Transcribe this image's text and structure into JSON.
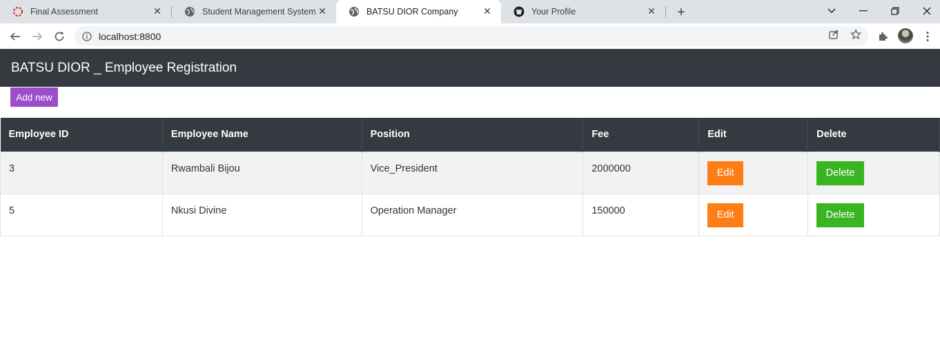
{
  "browser": {
    "tabs": [
      {
        "title": "Final Assessment",
        "icon": "loading-ring-icon",
        "active": false
      },
      {
        "title": "Student Management System",
        "icon": "globe-icon",
        "active": false
      },
      {
        "title": "BATSU DIOR Company",
        "icon": "globe-icon",
        "active": true
      },
      {
        "title": "Your Profile",
        "icon": "github-icon",
        "active": false
      }
    ],
    "url": "localhost:8800"
  },
  "header": {
    "title": "BATSU DIOR _ Employee Registration"
  },
  "actions": {
    "add_new_label": "Add new"
  },
  "table": {
    "columns": [
      "Employee ID",
      "Employee Name",
      "Position",
      "Fee",
      "Edit",
      "Delete"
    ],
    "rows": [
      {
        "id": "3",
        "name": "Rwambali Bijou",
        "position": "Vice_President",
        "fee": "2000000",
        "edit_label": "Edit",
        "delete_label": "Delete"
      },
      {
        "id": "5",
        "name": "Nkusi Divine",
        "position": "Operation Manager",
        "fee": "150000",
        "edit_label": "Edit",
        "delete_label": "Delete"
      }
    ]
  },
  "colors": {
    "header_bg": "#343a40",
    "add_new": "#9b4dca",
    "edit": "#fd7e14",
    "delete": "#3ab521"
  }
}
